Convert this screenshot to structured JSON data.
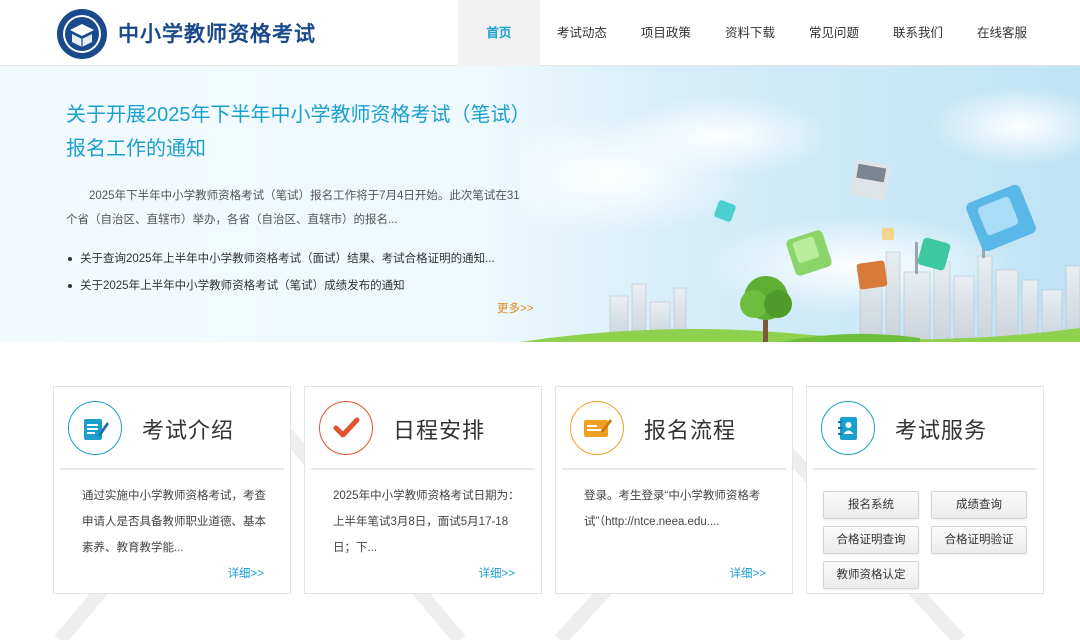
{
  "header": {
    "site_title": "中小学教师资格考试",
    "nav": [
      {
        "label": "首页",
        "active": true
      },
      {
        "label": "考试动态"
      },
      {
        "label": "项目政策"
      },
      {
        "label": "资料下载"
      },
      {
        "label": "常见问题"
      },
      {
        "label": "联系我们"
      },
      {
        "label": "在线客服"
      }
    ]
  },
  "banner": {
    "headline": "关于开展2025年下半年中小学教师资格考试（笔试）报名工作的通知",
    "summary": "2025年下半年中小学教师资格考试（笔试）报名工作将于7月4日开始。此次笔试在31个省（自治区、直辖市）举办，各省（自治区、直辖市）的报名...",
    "news": [
      "关于查询2025年上半年中小学教师资格考试（面试）结果、考试合格证明的通知...",
      "关于2025年上半年中小学教师资格考试（笔试）成绩发布的通知"
    ],
    "more": "更多>>"
  },
  "cards": [
    {
      "title": "考试介绍",
      "icon": "document-edit-icon",
      "color": "#1aa0cf",
      "desc": "通过实施中小学教师资格考试，考查申请人是否具备教师职业道德、基本素养、教育教学能...",
      "more": "详细>>"
    },
    {
      "title": "日程安排",
      "icon": "checkmark-icon",
      "color": "#e0552f",
      "desc": "2025年中小学教师资格考试日期为：上半年笔试3月8日，面试5月17-18日；下...",
      "more": "详细>>"
    },
    {
      "title": "报名流程",
      "icon": "registration-form-icon",
      "color": "#f0a020",
      "desc": "登录。考生登录“中小学教师资格考试”（http://ntce.neea.edu....",
      "more": "详细>>"
    },
    {
      "title": "考试服务",
      "icon": "contact-book-icon",
      "color": "#1aa0cf",
      "buttons": [
        "报名系统",
        "成绩查询",
        "合格证明查询",
        "合格证明验证",
        "教师资格认定"
      ]
    }
  ]
}
